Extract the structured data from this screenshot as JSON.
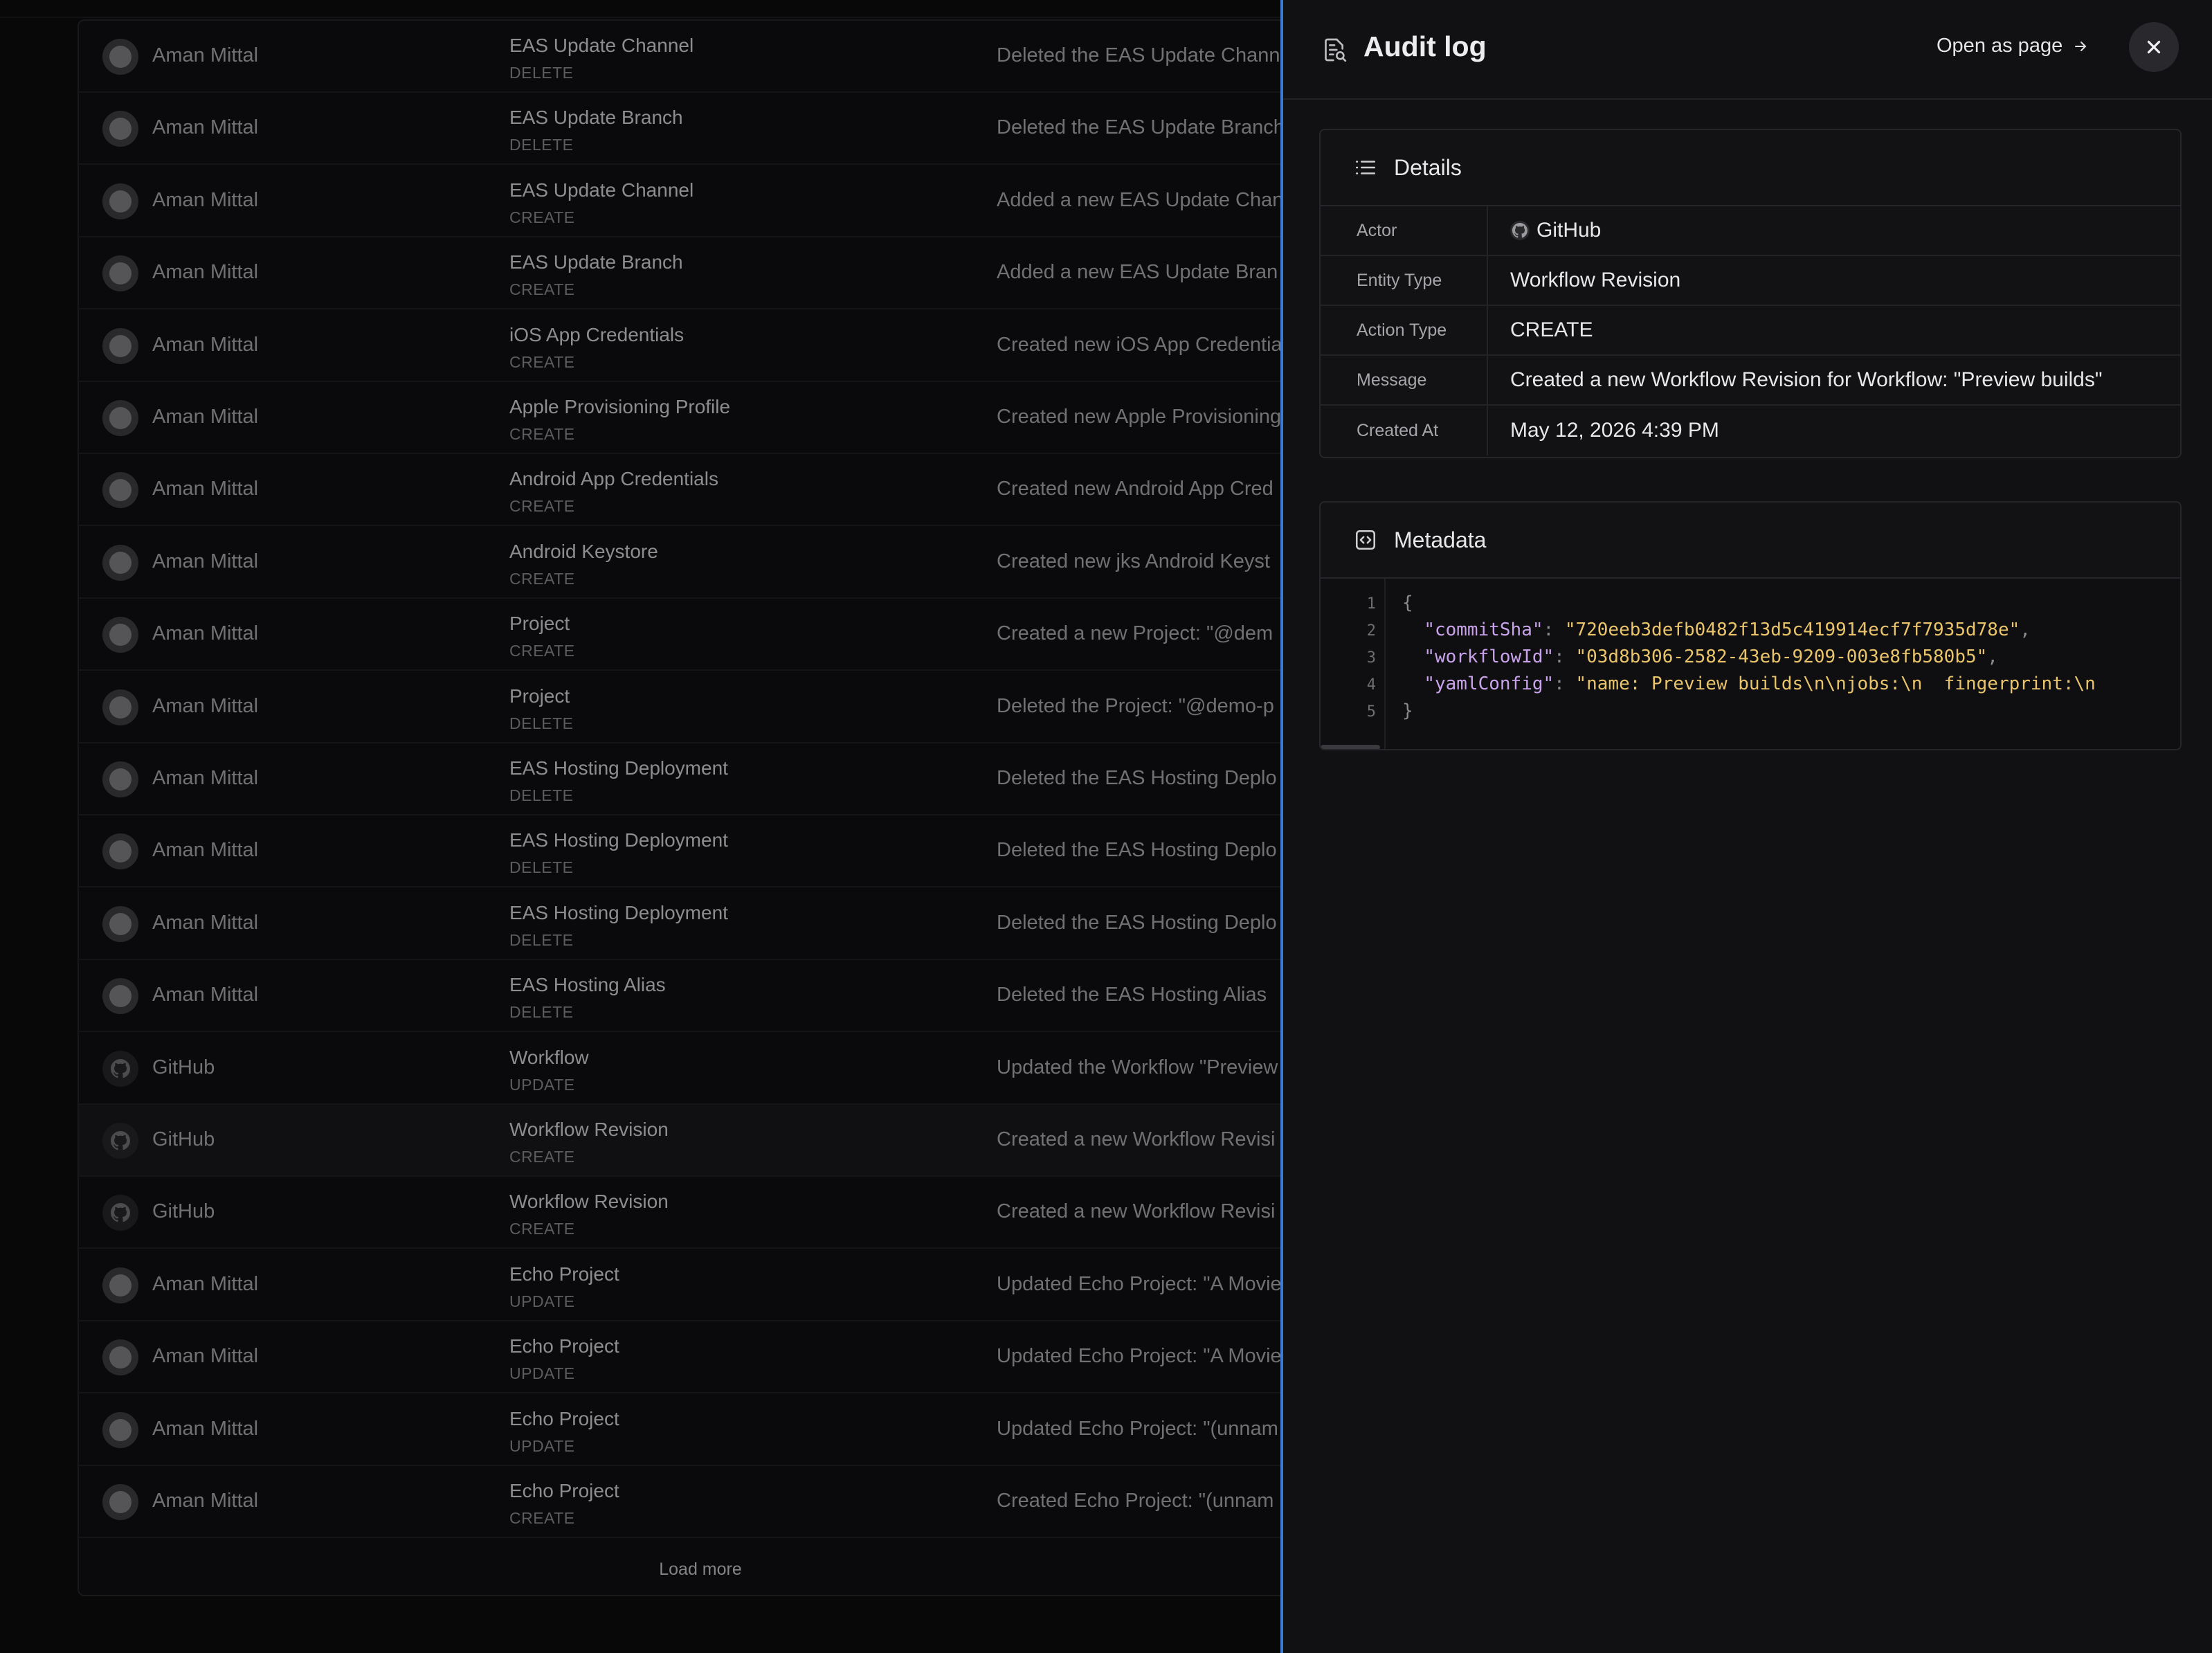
{
  "list": {
    "rows": [
      {
        "actor": "Aman Mittal",
        "actor_type": "user",
        "entity": "EAS Update Channel",
        "action": "DELETE",
        "message": "Deleted the EAS Update Chann"
      },
      {
        "actor": "Aman Mittal",
        "actor_type": "user",
        "entity": "EAS Update Branch",
        "action": "DELETE",
        "message": "Deleted the EAS Update Branch"
      },
      {
        "actor": "Aman Mittal",
        "actor_type": "user",
        "entity": "EAS Update Channel",
        "action": "CREATE",
        "message": "Added a new EAS Update Chan"
      },
      {
        "actor": "Aman Mittal",
        "actor_type": "user",
        "entity": "EAS Update Branch",
        "action": "CREATE",
        "message": "Added a new EAS Update Bran"
      },
      {
        "actor": "Aman Mittal",
        "actor_type": "user",
        "entity": "iOS App Credentials",
        "action": "CREATE",
        "message": "Created new iOS App Credentia"
      },
      {
        "actor": "Aman Mittal",
        "actor_type": "user",
        "entity": "Apple Provisioning Profile",
        "action": "CREATE",
        "message": "Created new Apple Provisioning"
      },
      {
        "actor": "Aman Mittal",
        "actor_type": "user",
        "entity": "Android App Credentials",
        "action": "CREATE",
        "message": "Created new Android App Cred"
      },
      {
        "actor": "Aman Mittal",
        "actor_type": "user",
        "entity": "Android Keystore",
        "action": "CREATE",
        "message": "Created new jks Android Keyst"
      },
      {
        "actor": "Aman Mittal",
        "actor_type": "user",
        "entity": "Project",
        "action": "CREATE",
        "message": "Created a new Project: \"@dem"
      },
      {
        "actor": "Aman Mittal",
        "actor_type": "user",
        "entity": "Project",
        "action": "DELETE",
        "message": "Deleted the Project: \"@demo-p"
      },
      {
        "actor": "Aman Mittal",
        "actor_type": "user",
        "entity": "EAS Hosting Deployment",
        "action": "DELETE",
        "message": "Deleted the EAS Hosting Deplo"
      },
      {
        "actor": "Aman Mittal",
        "actor_type": "user",
        "entity": "EAS Hosting Deployment",
        "action": "DELETE",
        "message": "Deleted the EAS Hosting Deplo"
      },
      {
        "actor": "Aman Mittal",
        "actor_type": "user",
        "entity": "EAS Hosting Deployment",
        "action": "DELETE",
        "message": "Deleted the EAS Hosting Deplo"
      },
      {
        "actor": "Aman Mittal",
        "actor_type": "user",
        "entity": "EAS Hosting Alias",
        "action": "DELETE",
        "message": "Deleted the EAS Hosting Alias"
      },
      {
        "actor": "GitHub",
        "actor_type": "github",
        "entity": "Workflow",
        "action": "UPDATE",
        "message": "Updated the Workflow \"Preview"
      },
      {
        "actor": "GitHub",
        "actor_type": "github",
        "entity": "Workflow Revision",
        "action": "CREATE",
        "message": "Created a new Workflow Revisi",
        "selected": true
      },
      {
        "actor": "GitHub",
        "actor_type": "github",
        "entity": "Workflow Revision",
        "action": "CREATE",
        "message": "Created a new Workflow Revisi"
      },
      {
        "actor": "Aman Mittal",
        "actor_type": "user",
        "entity": "Echo Project",
        "action": "UPDATE",
        "message": "Updated Echo Project: \"A Movie"
      },
      {
        "actor": "Aman Mittal",
        "actor_type": "user",
        "entity": "Echo Project",
        "action": "UPDATE",
        "message": "Updated Echo Project: \"A Movie"
      },
      {
        "actor": "Aman Mittal",
        "actor_type": "user",
        "entity": "Echo Project",
        "action": "UPDATE",
        "message": "Updated Echo Project: \"(unnam"
      },
      {
        "actor": "Aman Mittal",
        "actor_type": "user",
        "entity": "Echo Project",
        "action": "CREATE",
        "message": "Created Echo Project: \"(unnam"
      }
    ],
    "load_more_label": "Load more"
  },
  "panel": {
    "title": "Audit log",
    "open_as_page_label": "Open as page",
    "details": {
      "title": "Details",
      "rows": [
        {
          "label": "Actor",
          "value": "GitHub",
          "icon": "github-icon"
        },
        {
          "label": "Entity Type",
          "value": "Workflow Revision"
        },
        {
          "label": "Action Type",
          "value": "CREATE"
        },
        {
          "label": "Message",
          "value": "Created a new Workflow Revision for Workflow: \"Preview builds\""
        },
        {
          "label": "Created At",
          "value": "May 12, 2026 4:39 PM"
        }
      ]
    },
    "metadata": {
      "title": "Metadata",
      "line_numbers": [
        "1",
        "2",
        "3",
        "4",
        "5"
      ],
      "entries": [
        {
          "key": "\"commitSha\"",
          "value": "\"720eeb3defb0482f13d5c419914ecf7f7935d78e\""
        },
        {
          "key": "\"workflowId\"",
          "value": "\"03d8b306-2582-43eb-9209-003e8fb580b5\""
        },
        {
          "key": "\"yamlConfig\"",
          "value": "\"name: Preview builds\\n\\njobs:\\n  fingerprint:\\n"
        }
      ],
      "open_brace": "{",
      "close_brace": "}"
    }
  },
  "colors": {
    "accent": "#3d7bd0",
    "code_key": "#c8a2ea",
    "code_string": "#e9c46a"
  }
}
